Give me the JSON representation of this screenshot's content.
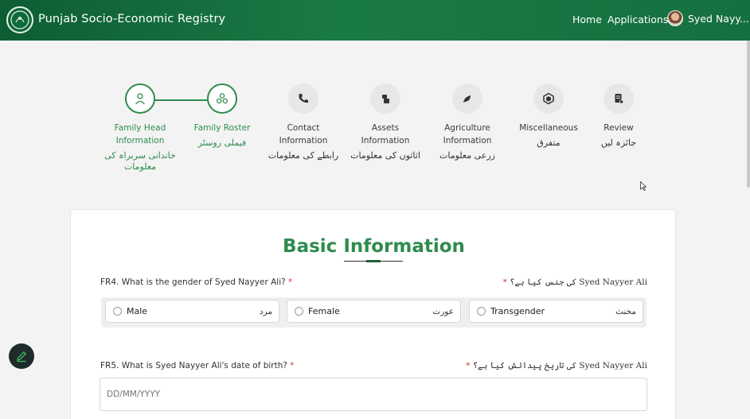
{
  "header": {
    "title": "Punjab Socio-Economic Registry",
    "nav": {
      "home": "Home",
      "applications": "Applications"
    },
    "user": {
      "name": "Syed Nayy..."
    }
  },
  "stepper": {
    "steps": [
      {
        "label": "Family Head Information",
        "urdu": "خاندانی سربراہ کی معلومات",
        "icon": "user-icon",
        "state": "active"
      },
      {
        "label": "Family Roster",
        "urdu": "فیملی روسٹر",
        "icon": "group-icon",
        "state": "active"
      },
      {
        "label": "Contact Information",
        "urdu": "رابطے کی معلومات",
        "icon": "phone-icon",
        "state": "pending"
      },
      {
        "label": "Assets Information",
        "urdu": "اثاثوں کی معلومات",
        "icon": "assets-icon",
        "state": "pending"
      },
      {
        "label": "Agriculture Information",
        "urdu": "زرعی معلومات",
        "icon": "agriculture-icon",
        "state": "pending"
      },
      {
        "label": "Miscellaneous",
        "urdu": "متفرق",
        "icon": "box-icon",
        "state": "pending"
      },
      {
        "label": "Review",
        "urdu": "جائزہ لیں",
        "icon": "document-icon",
        "state": "pending"
      }
    ]
  },
  "form": {
    "title": "Basic Information",
    "q4": {
      "label": "FR4. What is the gender of Syed Nayyer Ali?",
      "urdu": "Syed Nayyer Ali کی جنس کیا ہے؟",
      "options": [
        {
          "label": "Male",
          "urdu": "مرد"
        },
        {
          "label": "Female",
          "urdu": "عورت"
        },
        {
          "label": "Transgender",
          "urdu": "مخنث"
        }
      ]
    },
    "q5": {
      "label": "FR5. What is Syed Nayyer Ali's date of birth?",
      "urdu": "Syed Nayyer Ali کی تاریخ پیدائش کیا ہے؟",
      "placeholder": "DD/MM/YYYY"
    },
    "required_mark": "*"
  },
  "colors": {
    "primary": "#2e8b4e",
    "header": "#15703f"
  }
}
